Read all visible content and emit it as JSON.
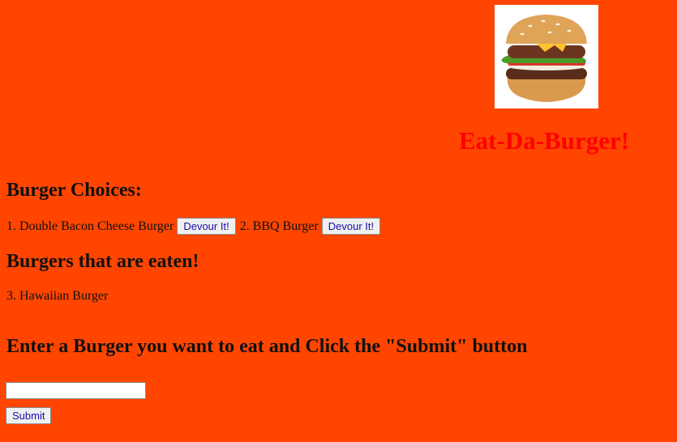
{
  "header": {
    "logo_icon": "hamburger-icon",
    "title": "Eat-Da-Burger!"
  },
  "choices": {
    "title": "Burger Choices:",
    "items": [
      {
        "label": "1. Double Bacon Cheese Burger",
        "button_label": "Devour It!"
      },
      {
        "label": "2. BBQ Burger",
        "button_label": "Devour It!"
      }
    ]
  },
  "eaten": {
    "title": "Burgers that are eaten!",
    "items": [
      {
        "label": "3. Hawaiian Burger"
      }
    ]
  },
  "form": {
    "title": "Enter a Burger you want to eat and Click the \"Submit\" button",
    "input_value": "",
    "submit_label": "Submit"
  },
  "colors": {
    "background": "#ff4500",
    "title": "#ff0000"
  }
}
